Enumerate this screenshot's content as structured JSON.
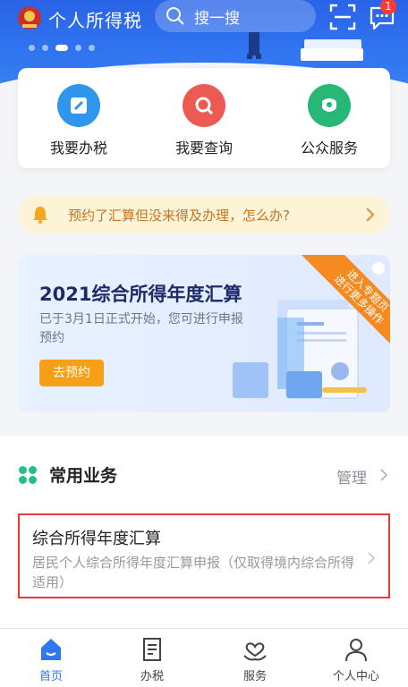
{
  "header": {
    "app_title": "个人所得税",
    "search_placeholder": "搜一搜",
    "message_badge": "1",
    "carousel_count": 5,
    "carousel_active_index": 2
  },
  "quick_actions": [
    {
      "label": "我要办税",
      "icon": "edit-icon",
      "color": "#2f96ee"
    },
    {
      "label": "我要查询",
      "icon": "search-icon",
      "color": "#ec5a52"
    },
    {
      "label": "公众服务",
      "icon": "service-icon",
      "color": "#27b777"
    }
  ],
  "notice": {
    "text": "预约了汇算但没来得及办理，怎么办?"
  },
  "promo": {
    "title": "2021综合所得年度汇算",
    "description": "已于3月1日正式开始，您可进行申报预约",
    "button_label": "去预约",
    "ribbon_line1": "进入专题页",
    "ribbon_line2": "进行更多操作"
  },
  "common_business": {
    "title": "常用业务",
    "manage_label": "管理",
    "items": [
      {
        "title": "综合所得年度汇算",
        "description": "居民个人综合所得年度汇算申报（仅取得境内综合所得适用）"
      }
    ]
  },
  "tabbar": [
    {
      "label": "首页",
      "icon": "home-icon",
      "active": true
    },
    {
      "label": "办税",
      "icon": "document-icon",
      "active": false
    },
    {
      "label": "服务",
      "icon": "heart-hand-icon",
      "active": false
    },
    {
      "label": "个人中心",
      "icon": "user-icon",
      "active": false
    }
  ],
  "colors": {
    "primary": "#2f71ef",
    "accent_orange": "#f5a016",
    "highlight_red": "#e83a3a"
  }
}
